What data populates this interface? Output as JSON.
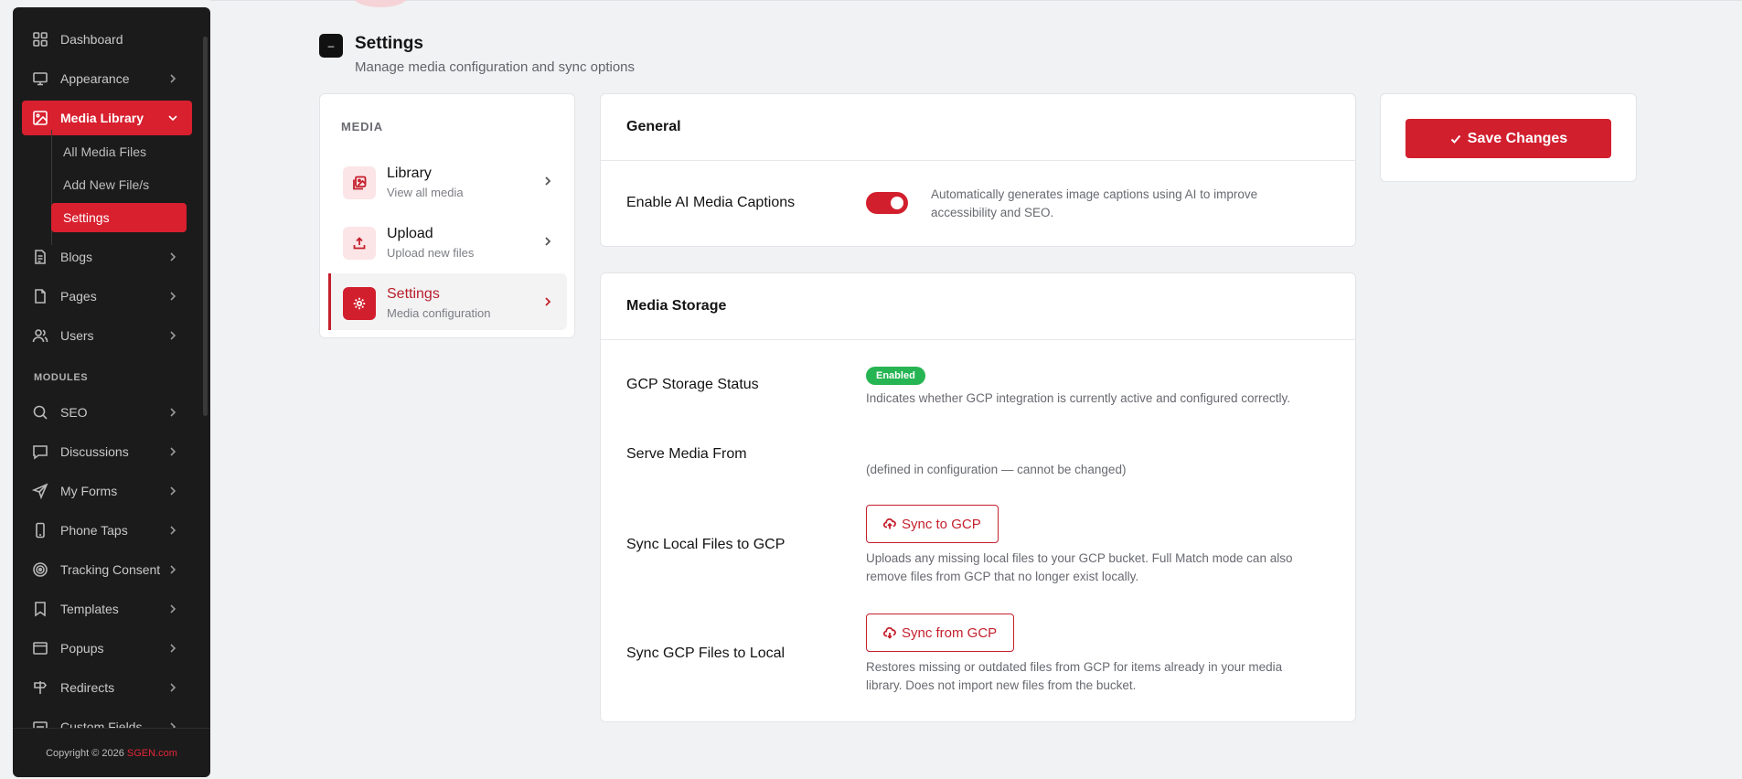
{
  "sidebar": {
    "items": [
      {
        "label": "Dashboard",
        "icon": "grid-icon"
      },
      {
        "label": "Appearance",
        "icon": "monitor-icon"
      },
      {
        "label": "Media Library",
        "icon": "image-icon"
      },
      {
        "label": "Blogs",
        "icon": "document-icon"
      },
      {
        "label": "Pages",
        "icon": "page-icon"
      },
      {
        "label": "Users",
        "icon": "users-icon"
      }
    ],
    "sub_items": [
      "All Media Files",
      "Add New File/s",
      "Settings"
    ],
    "section_label": "MODULES",
    "modules": [
      {
        "label": "SEO",
        "icon": "search-icon"
      },
      {
        "label": "Discussions",
        "icon": "chat-icon"
      },
      {
        "label": "My Forms",
        "icon": "send-icon"
      },
      {
        "label": "Phone Taps",
        "icon": "phone-icon"
      },
      {
        "label": "Tracking Consent",
        "icon": "target-icon"
      },
      {
        "label": "Templates",
        "icon": "bookmark-icon"
      },
      {
        "label": "Popups",
        "icon": "window-icon"
      },
      {
        "label": "Redirects",
        "icon": "signpost-icon"
      },
      {
        "label": "Custom Fields",
        "icon": "custom-fields-icon"
      }
    ],
    "footer_text": "Copyright © 2026 ",
    "footer_brand": "SGEN.com"
  },
  "header": {
    "icon_glyph": "–",
    "title": "Settings",
    "subtitle": "Manage media configuration and sync options"
  },
  "media_menu": {
    "label": "MEDIA",
    "items": [
      {
        "title": "Library",
        "subtitle": "View all media"
      },
      {
        "title": "Upload",
        "subtitle": "Upload new files"
      },
      {
        "title": "Settings",
        "subtitle": "Media configuration"
      }
    ]
  },
  "general": {
    "title": "General",
    "ai_captions_label": "Enable AI Media Captions",
    "ai_captions_enabled": true,
    "ai_captions_desc_1": "Automatically generates image captions using AI to improve",
    "ai_captions_desc_2": "accessibility and SEO."
  },
  "storage": {
    "title": "Media Storage",
    "status_label": "GCP Storage Status",
    "status_badge": "Enabled",
    "status_desc": "Indicates whether GCP integration is currently active and configured correctly.",
    "serve_label": "Serve Media From",
    "serve_desc": "(defined in configuration — cannot be changed)",
    "sync_to_label": "Sync Local Files to GCP",
    "sync_to_button": "Sync to GCP",
    "sync_to_desc_1": "Uploads any missing local files to your GCP bucket. Full Match mode can also",
    "sync_to_desc_2": "remove files from GCP that no longer exist locally.",
    "sync_from_label": "Sync GCP Files to Local",
    "sync_from_button": "Sync from GCP",
    "sync_from_desc_1": "Restores missing or outdated files from GCP for items already in your media",
    "sync_from_desc_2": "library. Does not import new files from the bucket."
  },
  "actions": {
    "save_label": "Save Changes"
  },
  "colors": {
    "accent": "#d21f2e",
    "sidebar_bg": "#1c1b1b",
    "badge_green": "#26b552",
    "page_bg": "#f1f2f4"
  }
}
